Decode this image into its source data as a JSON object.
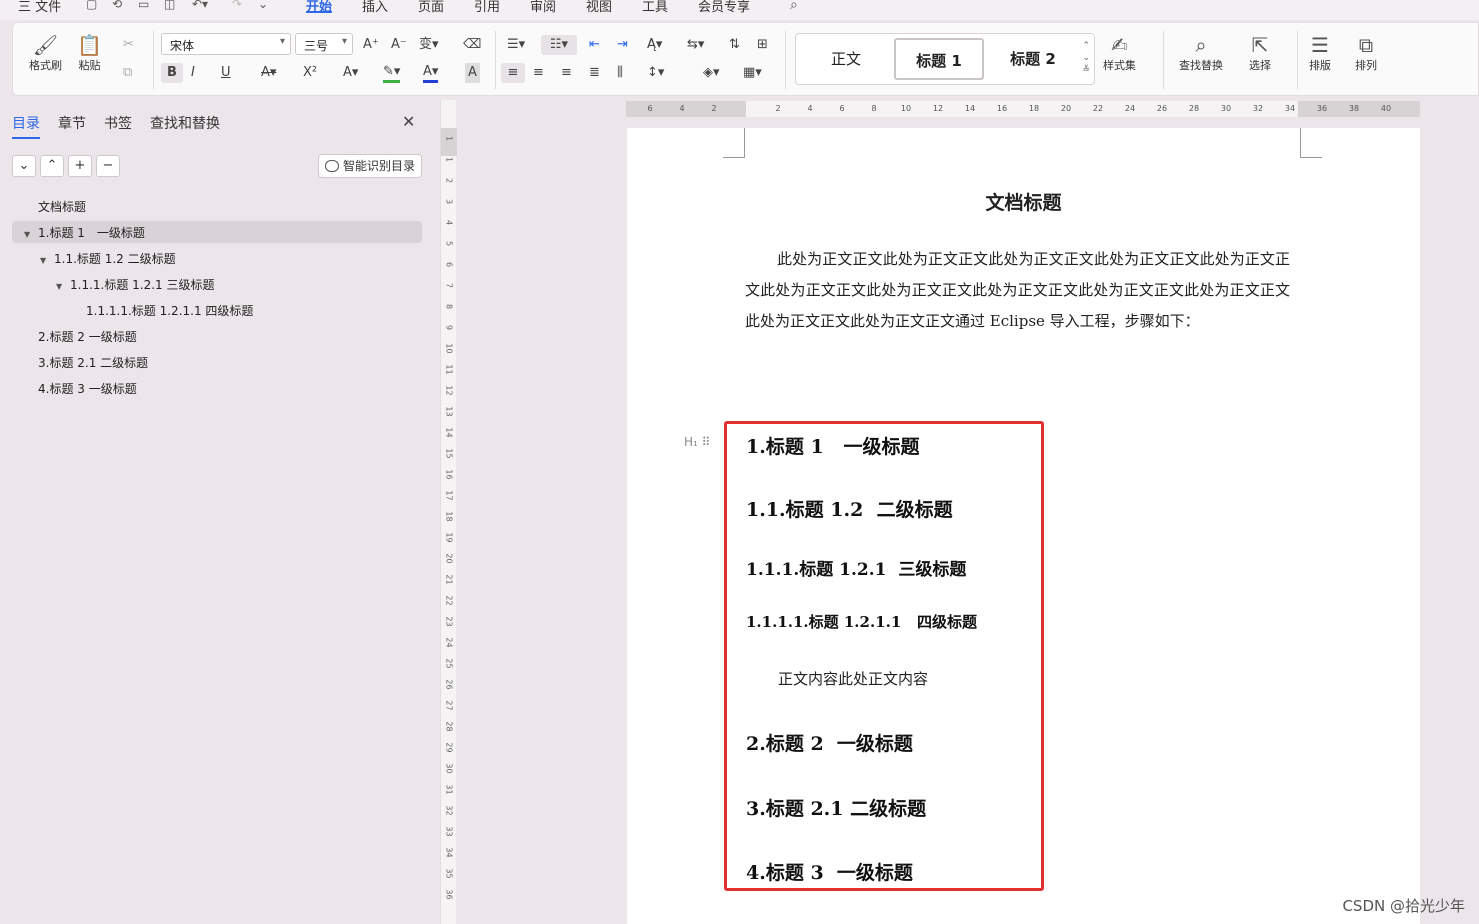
{
  "menubar": {
    "file": "三 文件",
    "tabs": [
      "开始",
      "插入",
      "页面",
      "引用",
      "审阅",
      "视图",
      "工具",
      "会员专享"
    ]
  },
  "ribbon": {
    "format_painter": "格式刷",
    "paste": "粘贴",
    "font_name": "宋体",
    "font_size": "三号",
    "bold": "B",
    "italic": "I",
    "underline": "U",
    "superscript": "X²",
    "styles": {
      "normal": "正文",
      "heading1": "标题 1",
      "heading2": "标题 2"
    },
    "style_set": "样式集",
    "find_replace": "查找替换",
    "select": "选择",
    "layout": "排版",
    "arrange": "排列"
  },
  "nav": {
    "tabs": [
      "目录",
      "章节",
      "书签",
      "查找和替换"
    ],
    "smart_toc": "智能识别目录",
    "toc": [
      {
        "text": "文档标题"
      },
      {
        "text": "1.标题 1　一级标题"
      },
      {
        "text": "1.1.标题 1.2  二级标题"
      },
      {
        "text": "1.1.1.标题 1.2.1  三级标题"
      },
      {
        "text": "1.1.1.1.标题 1.2.1.1   四级标题"
      },
      {
        "text": "2.标题 2  一级标题"
      },
      {
        "text": "3.标题 2.1 二级标题"
      },
      {
        "text": "4.标题 3  一级标题"
      }
    ]
  },
  "rulers": {
    "h_left": [
      "6",
      "4",
      "2"
    ],
    "h_right": [
      "2",
      "4",
      "6",
      "8",
      "10",
      "12",
      "14",
      "16",
      "18",
      "20",
      "22",
      "24",
      "26",
      "28",
      "30",
      "32",
      "34",
      "36",
      "38",
      "40"
    ],
    "v": [
      "1",
      "1",
      "2",
      "3",
      "4",
      "5",
      "6",
      "7",
      "8",
      "9",
      "10",
      "11",
      "12",
      "13",
      "14",
      "15",
      "16",
      "17",
      "18",
      "19",
      "20",
      "21",
      "22",
      "23",
      "24",
      "25",
      "26",
      "27",
      "28",
      "29",
      "30",
      "31",
      "32",
      "33",
      "34",
      "35",
      "36"
    ]
  },
  "document": {
    "title": "文档标题",
    "body": "此处为正文正文此处为正文正文此处为正文正文此处为正文正文此处为正文正文此处为正文正文此处为正文正文此处为正文正文此处为正文正文此处为正文正文此处为正文正文此处为正文正文通过 Eclipse 导入工程，步骤如下：",
    "heading_mark": "H",
    "headings": [
      "1.标题 1   一级标题",
      "1.1.标题 1.2  二级标题",
      "1.1.1.标题 1.2.1  三级标题",
      "1.1.1.1.标题 1.2.1.1   四级标题",
      "2.标题 2  一级标题",
      "3.标题 2.1 二级标题",
      "4.标题 3  一级标题"
    ],
    "body2": "正文内容此处正文内容"
  },
  "watermark": "CSDN @拾光少年",
  "colors": {
    "accent": "#2b67e8",
    "highlight_box": "#e0312f"
  }
}
